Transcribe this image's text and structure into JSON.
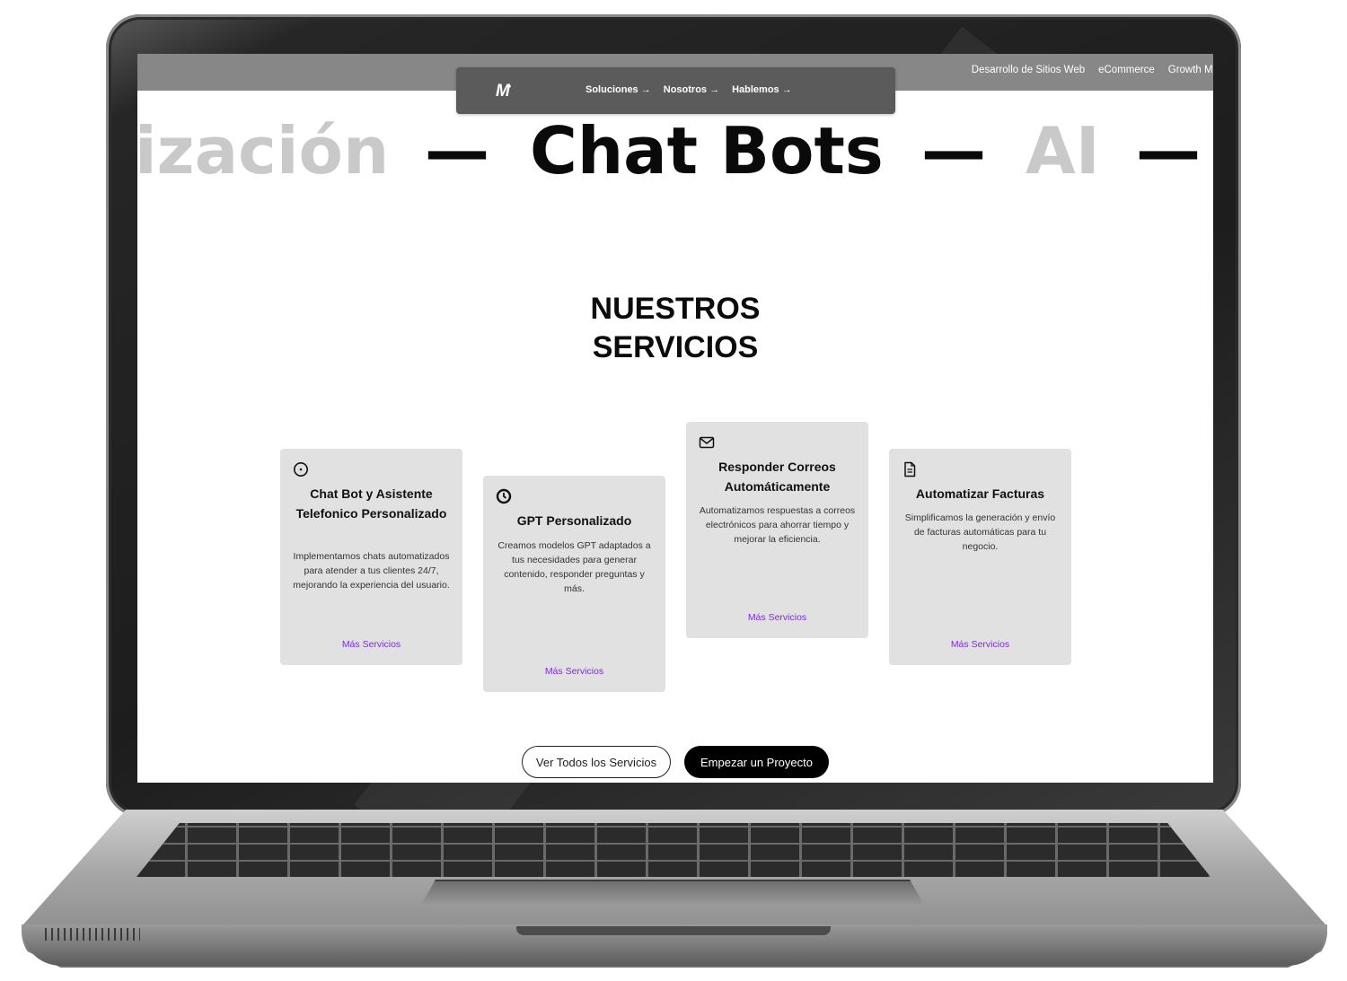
{
  "topbar": {
    "links": [
      "Desarrollo de Sitios Web",
      "eCommerce",
      "Growth Ma"
    ]
  },
  "nav": {
    "logo": "M",
    "logo_mark": "•",
    "items": [
      "Soluciones →",
      "Nosotros →",
      "Hablemos →"
    ]
  },
  "marquee": {
    "items": [
      "ización",
      "—",
      "Chat Bots",
      "—",
      "AI",
      "—"
    ]
  },
  "section": {
    "title_line1": "NUESTROS",
    "title_line2": "SERVICIOS"
  },
  "cards": [
    {
      "icon": "info-circle-icon",
      "title": "Chat Bot y Asistente Telefonico Personalizado",
      "description": "Implementamos chats automatizados para atender a tus clientes 24/7, mejorando la experiencia del usuario.",
      "link": "Más Servicios"
    },
    {
      "icon": "clock-icon",
      "title": "GPT Personalizado",
      "description": "Creamos modelos GPT adaptados a tus necesidades para generar contenido, responder preguntas y más.",
      "link": "Más Servicios"
    },
    {
      "icon": "mail-icon",
      "title": "Responder Correos Automáticamente",
      "description": "Automatizamos respuestas a correos electrónicos para ahorrar tiempo y mejorar la eficiencia.",
      "link": "Más Servicios"
    },
    {
      "icon": "document-icon",
      "title": "Automatizar Facturas",
      "description": "Simplificamos la generación y envío de facturas automáticas para tu negocio.",
      "link": "Más Servicios"
    }
  ],
  "buttons": {
    "secondary": "Ver Todos los Servicios",
    "primary": "Empezar un Proyecto"
  },
  "colors": {
    "link": "#7a2fd6",
    "card_bg": "#e1e1e1",
    "topbar_bg": "#878787",
    "nav_bg": "#5b5b5b"
  }
}
